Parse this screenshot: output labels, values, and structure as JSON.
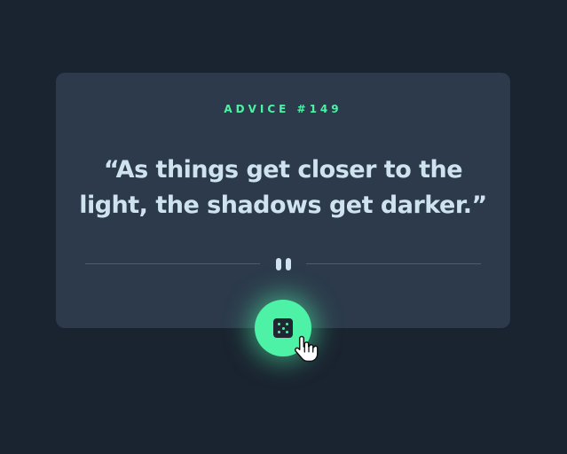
{
  "card": {
    "advice_label": "ADVICE #149",
    "quote": "“As things get closer to the light, the shadows get darker.”"
  },
  "divider": {
    "icon": "pause-icon"
  },
  "dice_button": {
    "icon": "dice-icon"
  },
  "colors": {
    "background": "#1a2330",
    "card": "#2c3a4b",
    "accent": "#4ef2a6",
    "text": "#cfe3ee"
  }
}
